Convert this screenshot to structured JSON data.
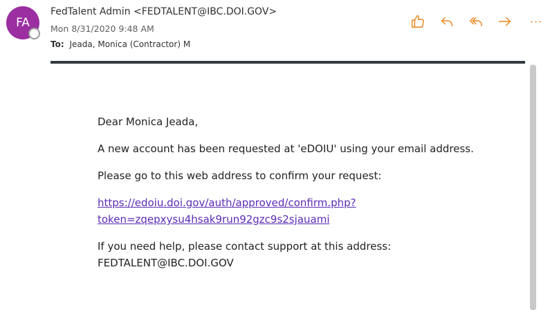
{
  "header": {
    "avatar_initials": "FA",
    "sender": "FedTalent Admin <FEDTALENT@IBC.DOI.GOV>",
    "date": "Mon 8/31/2020 9:48 AM",
    "to_label": "To:",
    "to_value": "Jeada, Monica (Contractor) M",
    "accent_color": "#e8861c",
    "avatar_color": "#9b2ea0"
  },
  "actions": [
    {
      "icon": "like-icon"
    },
    {
      "icon": "reply-icon"
    },
    {
      "icon": "reply-all-icon"
    },
    {
      "icon": "forward-icon"
    },
    {
      "icon": "more-icon"
    }
  ],
  "message": {
    "greeting": "Dear Monica Jeada,",
    "para1": "A new account has been requested at 'eDOIU' using your email address.",
    "para2": "Please go to this web address to confirm your request:",
    "link_line1": "https://edoiu.doi.gov/auth/approved/confirm.php?",
    "link_line2": "token=zqepxysu4hsak9run92gzc9s2sjauami",
    "para3_line1": "If you need help, please contact support at this address:",
    "para3_line2": "FEDTALENT@IBC.DOI.GOV"
  }
}
